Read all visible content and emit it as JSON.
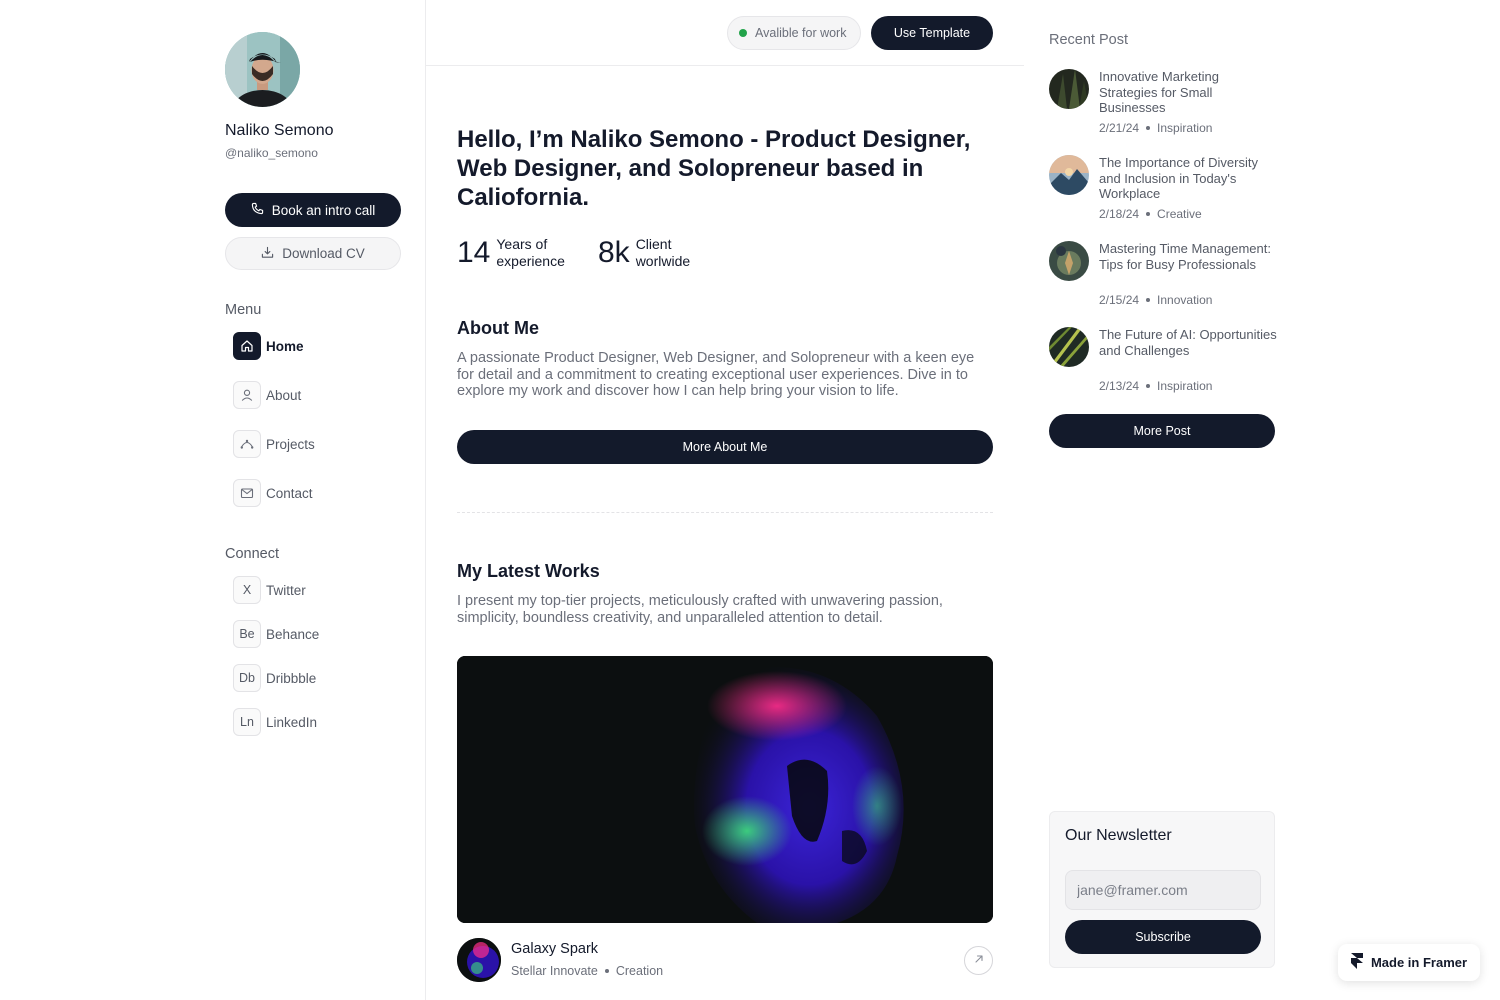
{
  "profile": {
    "name": "Naliko Semono",
    "handle": "@naliko_semono",
    "book_label": "Book an intro call",
    "cv_label": "Download CV"
  },
  "menu": {
    "title": "Menu",
    "items": [
      {
        "label": "Home",
        "icon": "home-icon",
        "active": true
      },
      {
        "label": "About",
        "icon": "user-icon",
        "active": false
      },
      {
        "label": "Projects",
        "icon": "projects-icon",
        "active": false
      },
      {
        "label": "Contact",
        "icon": "mail-icon",
        "active": false
      }
    ]
  },
  "connect": {
    "title": "Connect",
    "items": [
      {
        "label": "Twitter",
        "abbr": "X"
      },
      {
        "label": "Behance",
        "abbr": "Be"
      },
      {
        "label": "Dribbble",
        "abbr": "Db"
      },
      {
        "label": "LinkedIn",
        "abbr": "Ln"
      }
    ]
  },
  "topbar": {
    "status": "Avalible for work",
    "status_color": "#22a34a",
    "template_label": "Use Template"
  },
  "hero": {
    "headline": "Hello, I’m Naliko Semono - Product Designer, Web Designer, and Solopreneur based in Caliofornia.",
    "stats": [
      {
        "value": "14",
        "label_line1": "Years of",
        "label_line2": "experience"
      },
      {
        "value": "8k",
        "label_line1": "Client",
        "label_line2": "worlwide"
      }
    ]
  },
  "about": {
    "title": "About Me",
    "text": "A passionate Product Designer, Web Designer, and Solopreneur with a keen eye for detail and a commitment to creating exceptional user experiences. Dive in to explore my work and discover how I can help bring your vision to life.",
    "button": "More About Me"
  },
  "works": {
    "title": "My Latest Works",
    "text": "I present my top-tier projects, meticulously crafted with unwavering passion, simplicity, boundless creativity, and unparalleled attention to detail.",
    "items": [
      {
        "title": "Galaxy Spark",
        "client": "Stellar Innovate",
        "category": "Creation"
      }
    ]
  },
  "recent": {
    "title": "Recent Post",
    "posts": [
      {
        "title": "Innovative Marketing Strategies for Small Businesses",
        "date": "2/21/24",
        "category": "Inspiration"
      },
      {
        "title": "The Importance of Diversity and Inclusion in Today's Workplace",
        "date": "2/18/24",
        "category": "Creative"
      },
      {
        "title": "Mastering Time Management: Tips for Busy Professionals",
        "date": "2/15/24",
        "category": "Innovation"
      },
      {
        "title": "The Future of AI: Opportunities and Challenges",
        "date": "2/13/24",
        "category": "Inspiration"
      }
    ],
    "button": "More Post"
  },
  "newsletter": {
    "title": "Our Newsletter",
    "placeholder": "jane@framer.com",
    "button": "Subscribe"
  },
  "badge": {
    "label": "Made in Framer"
  },
  "colors": {
    "primary_dark": "#131a2b",
    "muted_text": "#6b6f7a",
    "status_green": "#22a34a"
  }
}
